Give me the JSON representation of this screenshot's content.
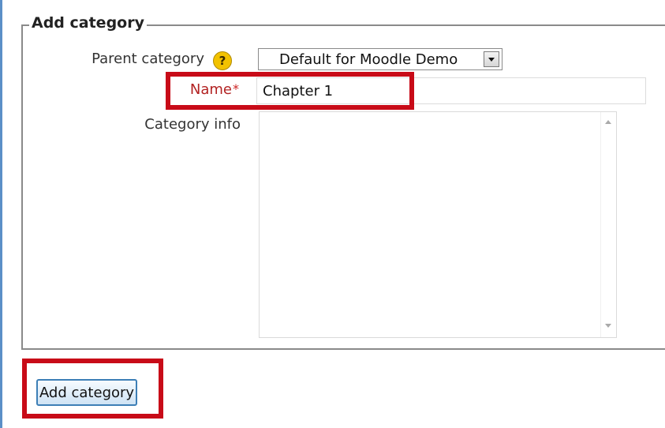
{
  "form": {
    "legend": "Add category",
    "parent_category": {
      "label": "Parent category",
      "help_icon": "help-icon",
      "help_glyph": "?",
      "selected": "Default for Moodle Demo"
    },
    "name": {
      "label": "Name",
      "required_marker": "*",
      "value": "Chapter 1"
    },
    "category_info": {
      "label": "Category info",
      "value": ""
    },
    "submit_label": "Add category"
  },
  "colors": {
    "highlight": "#c80b18",
    "required_label": "#b22222",
    "help_icon_bg": "#f2c200",
    "button_border": "#3d7fb6",
    "fieldset_border": "#8a8a8a"
  }
}
